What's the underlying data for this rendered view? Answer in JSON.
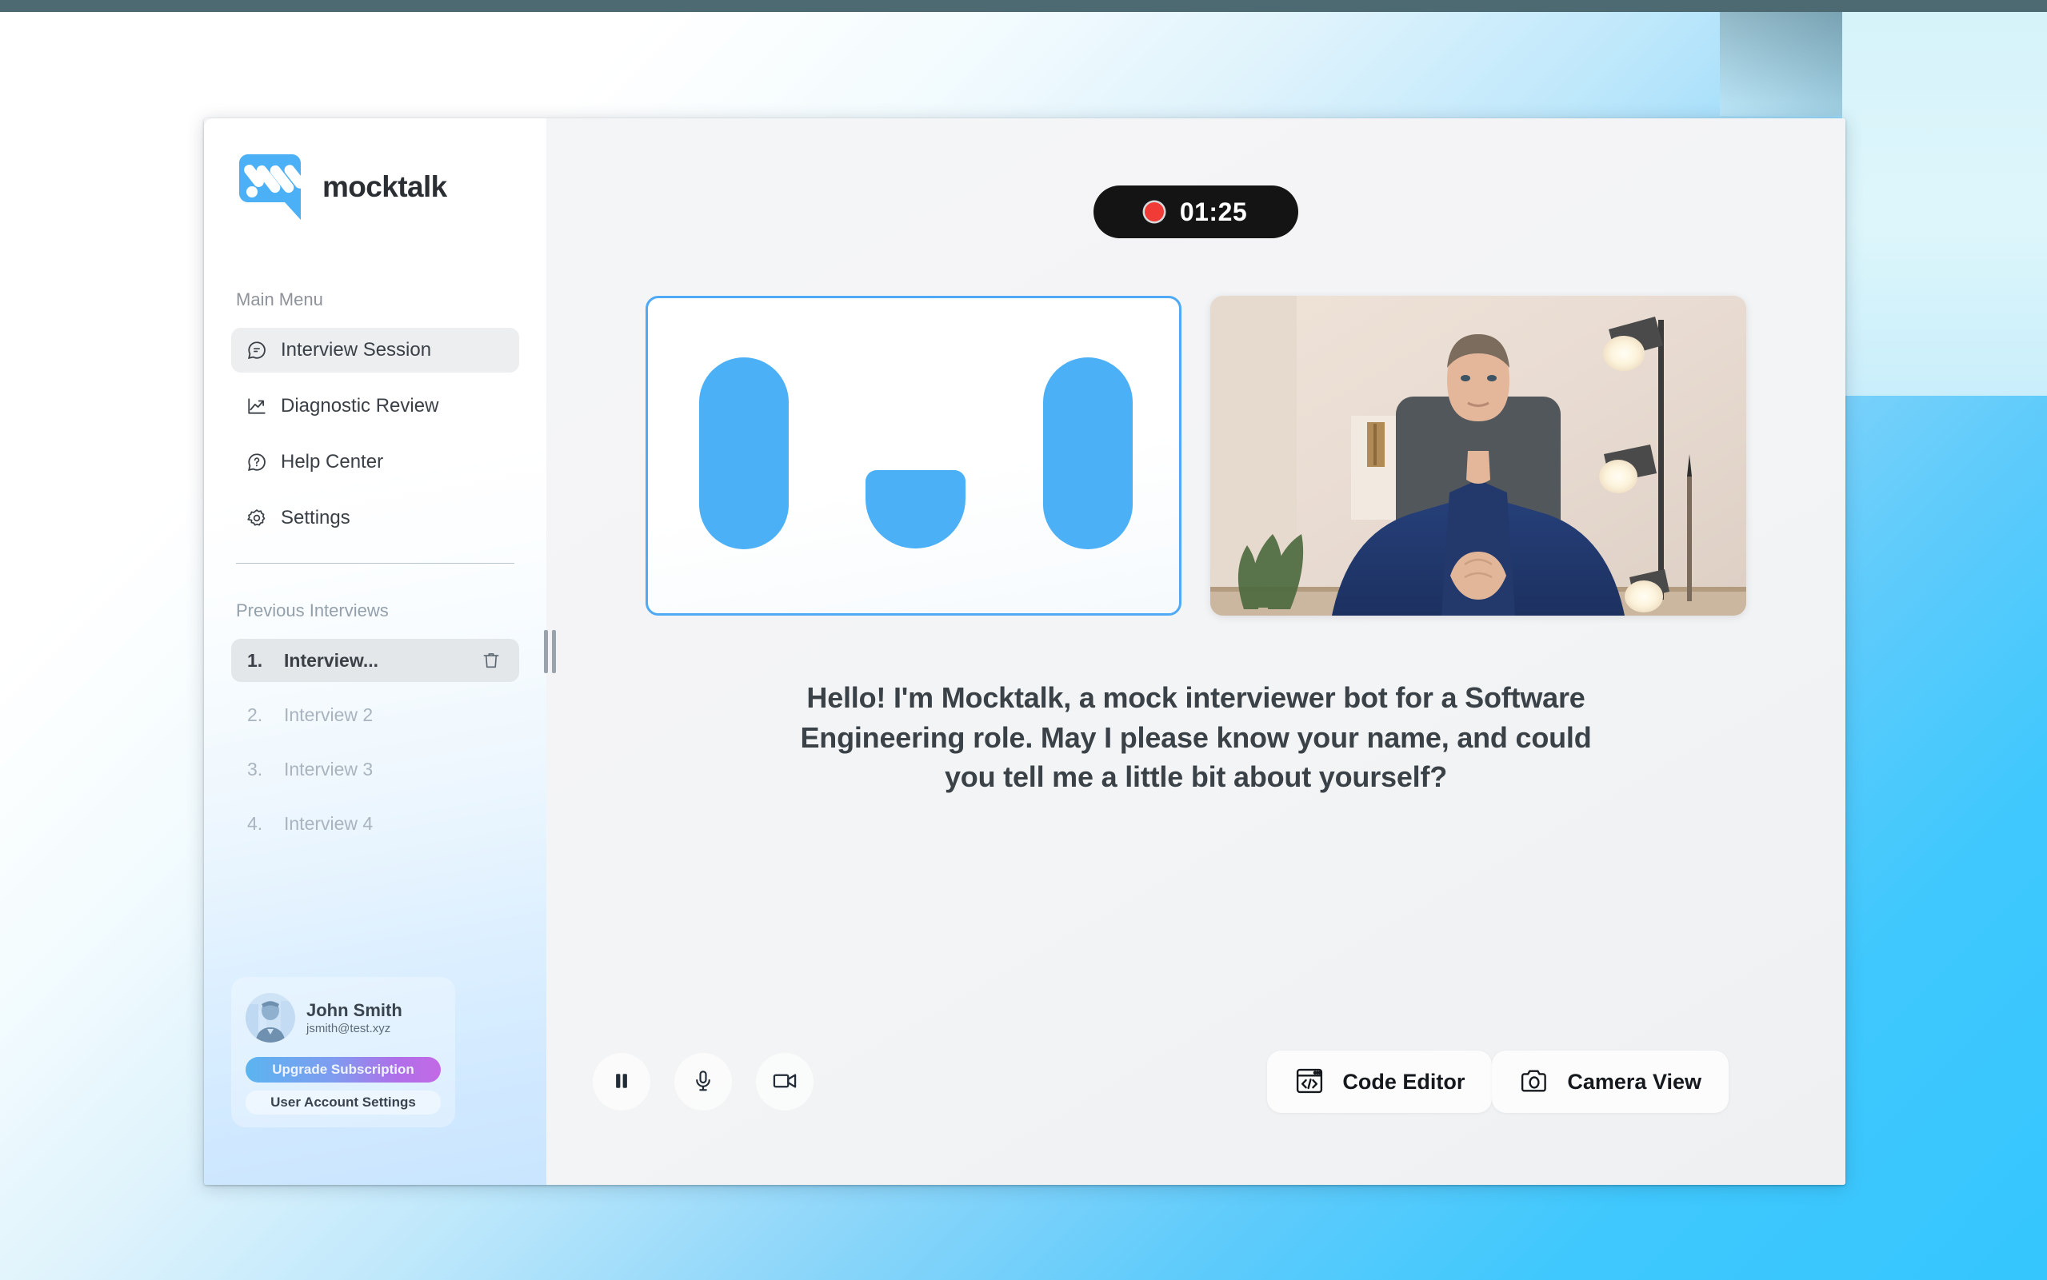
{
  "app": {
    "brand_name": "mocktalk",
    "logo_icon": "mocktalk-speech-bubble-logo"
  },
  "sidebar": {
    "main_menu_label": "Main Menu",
    "nav_items": [
      {
        "label": "Interview Session",
        "icon": "chat-bubble-icon",
        "active": true
      },
      {
        "label": "Diagnostic Review",
        "icon": "trend-chart-icon",
        "active": false
      },
      {
        "label": "Help Center",
        "icon": "question-circle-icon",
        "active": false
      },
      {
        "label": "Settings",
        "icon": "gear-icon",
        "active": false
      }
    ],
    "previous_interviews_label": "Previous Interviews",
    "previous_interviews": [
      {
        "num": "1.",
        "title": "Interview...",
        "active": true,
        "trash_icon": "trash-icon"
      },
      {
        "num": "2.",
        "title": "Interview 2",
        "active": false
      },
      {
        "num": "3.",
        "title": "Interview 3",
        "active": false
      },
      {
        "num": "4.",
        "title": "Interview 4",
        "active": false
      }
    ],
    "resize_handle_icon": "drag-handle-icon",
    "user": {
      "name": "John Smith",
      "email": "jsmith@test.xyz",
      "avatar_icon": "user-avatar",
      "upgrade_label": "Upgrade Subscription",
      "account_settings_label": "User Account Settings"
    }
  },
  "main": {
    "timer": {
      "time": "01:25",
      "recording_icon": "record-dot-icon"
    },
    "bot_panel": {
      "label": "mocktalk-bot-face",
      "eye_color": "#4cb0f7"
    },
    "camera_panel": {
      "label": "user-camera-feed"
    },
    "transcript": "Hello! I'm Mocktalk, a mock interviewer bot for a Software Engineering role. May I please know your name, and could you tell me a little bit about yourself?",
    "controls": {
      "pause_icon": "pause-icon",
      "mic_icon": "microphone-icon",
      "video_icon": "video-camera-icon",
      "code_editor_label": "Code Editor",
      "code_editor_icon": "code-window-icon",
      "camera_view_label": "Camera View",
      "camera_view_icon": "camera-icon"
    }
  },
  "colors": {
    "brand_blue": "#4cb0f7",
    "accent_border": "#4fa9f5",
    "record_red": "#f03b37",
    "timer_bg": "#141414",
    "desktop_cyan": "#35c6fe",
    "topbar": "#4d6a72"
  }
}
